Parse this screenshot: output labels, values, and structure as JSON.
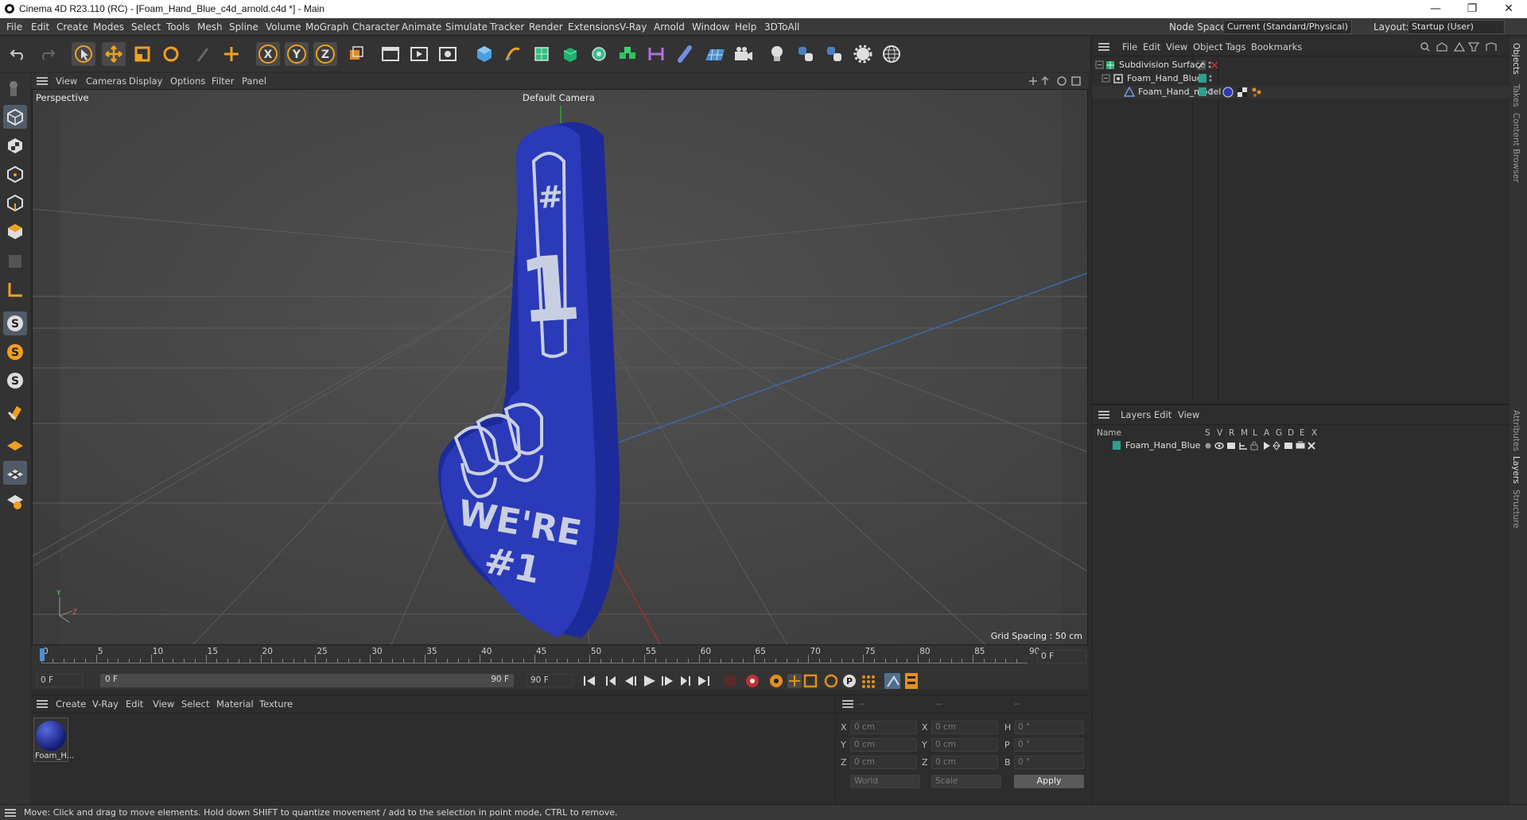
{
  "window": {
    "title": "Cinema 4D R23.110 (RC) - [Foam_Hand_Blue_c4d_arnold.c4d *] - Main",
    "minimize": "—",
    "maximize": "❐",
    "close": "✕"
  },
  "menu": {
    "items": [
      "File",
      "Edit",
      "Create",
      "Modes",
      "Select",
      "Tools",
      "Mesh",
      "Spline",
      "Volume",
      "MoGraph",
      "Character",
      "Animate",
      "Simulate",
      "Tracker",
      "Render",
      "Extensions",
      "V-Ray",
      "Arnold",
      "Window",
      "Help",
      "3DToAll"
    ],
    "node_space_label": "Node Space:",
    "node_space_value": "Current (Standard/Physical)",
    "layout_label": "Layout:",
    "layout_value": "Startup (User)"
  },
  "toolbar": {
    "icons": [
      "undo-icon",
      "redo-icon",
      "select-cursor-icon",
      "move-icon",
      "scale-icon",
      "rotate-icon",
      "live-select-icon",
      "move-axis-icon",
      "x-axis-lock-icon",
      "y-axis-lock-icon",
      "z-axis-lock-icon",
      "coordinate-system-icon",
      "render-region-icon",
      "render-view-icon",
      "render-settings-icon",
      "cube-icon",
      "pen-icon",
      "subdivision-icon",
      "extrude-icon",
      "cloner-icon",
      "mograph-icon",
      "deformer-icon",
      "spline-tool-icon",
      "floor-icon",
      "camera-icon",
      "light-icon",
      "python-icon",
      "python2-icon",
      "gear-icon",
      "globe-icon"
    ],
    "axis_x": "X",
    "axis_y": "Y",
    "axis_z": "Z"
  },
  "viewport": {
    "menu": [
      "View",
      "Cameras",
      "Display",
      "Options",
      "Filter",
      "Panel"
    ],
    "label": "Perspective",
    "camera": "Default Camera",
    "grid_spacing": "Grid Spacing : 50 cm",
    "axis_x": "Z",
    "axis_y": "Y",
    "model_text_top": "#",
    "model_text_mid": "1",
    "model_text_bot1": "WE'RE",
    "model_text_bot2": "#1"
  },
  "timeline": {
    "ticks": [
      "0",
      "5",
      "10",
      "15",
      "20",
      "25",
      "30",
      "35",
      "40",
      "45",
      "50",
      "55",
      "60",
      "65",
      "70",
      "75",
      "80",
      "85",
      "90"
    ],
    "current_frame_right": "0 F",
    "start_field": "0 F",
    "range_start": "0 F",
    "range_end": "90 F",
    "end_field": "90 F"
  },
  "materials": {
    "menu": [
      "Create",
      "V-Ray",
      "Edit",
      "View",
      "Select",
      "Material",
      "Texture"
    ],
    "items": [
      {
        "name": "Foam_H..."
      }
    ]
  },
  "coords": {
    "headers": [
      "--",
      "--",
      "--"
    ],
    "rows": [
      {
        "a": "X",
        "av": "0 cm",
        "b": "X",
        "bv": "0 cm",
        "c": "H",
        "cv": "0 °"
      },
      {
        "a": "Y",
        "av": "0 cm",
        "b": "Y",
        "bv": "0 cm",
        "c": "P",
        "cv": "0 °"
      },
      {
        "a": "Z",
        "av": "0 cm",
        "b": "Z",
        "bv": "0 cm",
        "c": "B",
        "cv": "0 °"
      }
    ],
    "space": "World",
    "mode": "Scale",
    "apply": "Apply"
  },
  "objects": {
    "menu": [
      "File",
      "Edit",
      "View",
      "Object",
      "Tags",
      "Bookmarks"
    ],
    "tree": [
      {
        "name": "Subdivision Surface",
        "indent": 0
      },
      {
        "name": "Foam_Hand_Blue",
        "indent": 1
      },
      {
        "name": "Foam_Hand_model",
        "indent": 2
      }
    ]
  },
  "layers": {
    "menu": [
      "Layers",
      "Edit",
      "View"
    ],
    "columns": {
      "name": "Name",
      "flags": [
        "S",
        "V",
        "R",
        "M",
        "L",
        "A",
        "G",
        "D",
        "E",
        "X"
      ]
    },
    "rows": [
      {
        "name": "Foam_Hand_Blue"
      }
    ]
  },
  "side_tabs": [
    "Objects",
    "Takes",
    "Content Browser",
    "Attributes",
    "Layers",
    "Structure"
  ],
  "status": "Move: Click and drag to move elements. Hold down SHIFT to quantize movement / add to the selection in point mode, CTRL to remove.",
  "colors": {
    "accent": "#4f8fd0",
    "model_blue": "#2535b8",
    "layer_green": "#2fa090"
  }
}
